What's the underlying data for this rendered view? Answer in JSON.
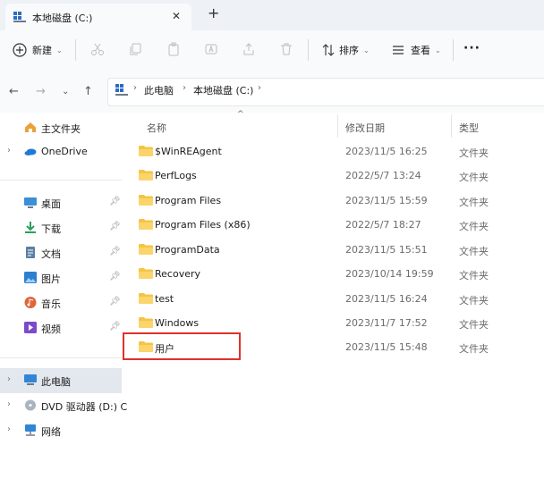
{
  "tab": {
    "title": "本地磁盘 (C:)",
    "close_glyph": "✕",
    "new_glyph": "+"
  },
  "toolbar": {
    "new_label": "新建",
    "sort_label": "排序",
    "view_label": "查看",
    "more_glyph": "···"
  },
  "address": {
    "crumbs": [
      "此电脑",
      "本地磁盘 (C:)"
    ]
  },
  "nav": {
    "home": "主文件夹",
    "onedrive": "OneDrive",
    "quick": [
      {
        "label": "桌面"
      },
      {
        "label": "下载"
      },
      {
        "label": "文档"
      },
      {
        "label": "图片"
      },
      {
        "label": "音乐"
      },
      {
        "label": "视频"
      }
    ],
    "this_pc": "此电脑",
    "dvd": "DVD 驱动器 (D:) C",
    "network": "网络"
  },
  "columns": {
    "name": "名称",
    "date": "修改日期",
    "type": "类型"
  },
  "files": [
    {
      "name": "$WinREAgent",
      "date": "2023/11/5 16:25",
      "type": "文件夹"
    },
    {
      "name": "PerfLogs",
      "date": "2022/5/7 13:24",
      "type": "文件夹"
    },
    {
      "name": "Program Files",
      "date": "2023/11/5 15:59",
      "type": "文件夹"
    },
    {
      "name": "Program Files (x86)",
      "date": "2022/5/7 18:27",
      "type": "文件夹"
    },
    {
      "name": "ProgramData",
      "date": "2023/11/5 15:51",
      "type": "文件夹"
    },
    {
      "name": "Recovery",
      "date": "2023/10/14 19:59",
      "type": "文件夹"
    },
    {
      "name": "test",
      "date": "2023/11/5 16:24",
      "type": "文件夹"
    },
    {
      "name": "Windows",
      "date": "2023/11/7 17:52",
      "type": "文件夹"
    },
    {
      "name": "用户",
      "date": "2023/11/5 15:48",
      "type": "文件夹"
    }
  ],
  "colors": {
    "folder": "#f6c444",
    "highlight": "#e0312a",
    "selected_bg": "#e3e7ee"
  }
}
